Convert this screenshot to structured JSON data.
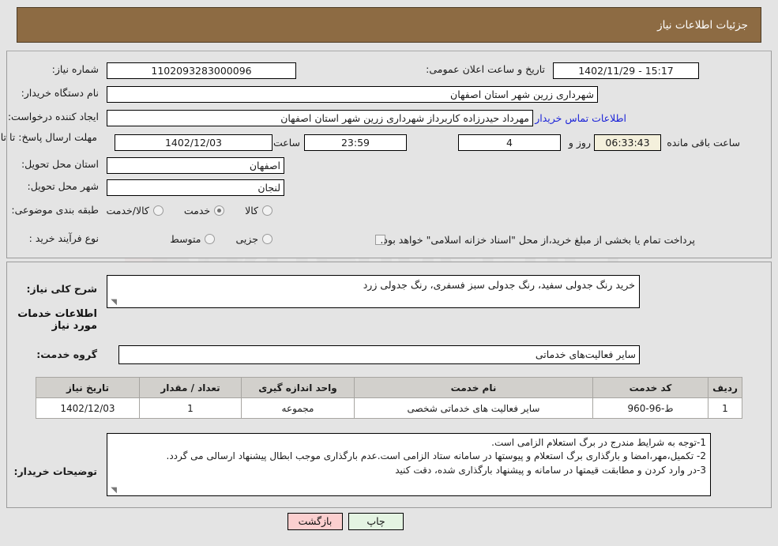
{
  "header": {
    "title": "جزئیات اطلاعات نیاز"
  },
  "top_form": {
    "need_number_label": "شماره نیاز:",
    "need_number_value": "1102093283000096",
    "public_announce_label": "تاریخ و ساعت اعلان عمومی:",
    "public_announce_value": "15:17 - 1402/11/29",
    "buyer_org_label": "نام دستگاه خریدار:",
    "buyer_org_value": "شهرداری زرین شهر استان اصفهان",
    "creator_label": "ایجاد کننده درخواست:",
    "creator_value": "مهرداد حیدرزاده کاربرداز شهرداری زرین شهر استان اصفهان",
    "buyer_contact_link": "اطلاعات تماس خریدار",
    "deadline_label": "مهلت ارسال پاسخ: تا تاریخ:",
    "deadline_date": "1402/12/03",
    "deadline_hour_label": "ساعت",
    "deadline_hour": "23:59",
    "remaining_days": "4",
    "remaining_days_label": "روز و",
    "remaining_time": "06:33:43",
    "remaining_time_label": "ساعت باقی مانده",
    "province_label": "استان محل تحویل:",
    "province_value": "اصفهان",
    "city_label": "شهر محل تحویل:",
    "city_value": "لنجان",
    "classification_label": "طبقه بندی موضوعی:",
    "classification_options": [
      {
        "label": "کالا",
        "selected": false
      },
      {
        "label": "خدمت",
        "selected": true
      },
      {
        "label": "کالا/خدمت",
        "selected": false
      }
    ],
    "process_type_label": "نوع فرآیند خرید :",
    "process_type_options": [
      {
        "label": "جزیی",
        "selected": false
      },
      {
        "label": "متوسط",
        "selected": false
      }
    ],
    "treasury_checkbox_checked": false,
    "treasury_text": "پرداخت تمام یا بخشی از مبلغ خرید،از محل \"اسناد خزانه اسلامی\" خواهد بود."
  },
  "need_description": {
    "label": "شرح کلی نیاز:",
    "value": "خرید رنگ جدولی سفید، رنگ جدولی سبز فسفری، رنگ جدولی زرد"
  },
  "services_section": {
    "heading": "اطلاعات خدمات مورد نیاز",
    "group_label": "گروه خدمت:",
    "group_value": "سایر فعالیت‌های خدماتی"
  },
  "services_table": {
    "columns": [
      "ردیف",
      "کد خدمت",
      "نام خدمت",
      "واحد اندازه گیری",
      "تعداد / مقدار",
      "تاریخ نیاز"
    ],
    "rows": [
      {
        "row_no": "1",
        "code": "ط-96-960",
        "name": "سایر فعالیت های خدماتی شخصی",
        "unit": "مجموعه",
        "quantity": "1",
        "need_date": "1402/12/03"
      }
    ]
  },
  "buyer_notes": {
    "label": "توضیحات خریدار:",
    "lines": [
      "1-توجه به شرایط مندرج در برگ استعلام الزامی است.",
      "2- تکمیل،مهر،امضا و بارگذاری برگ استعلام و پیوستها در سامانه ستاد الزامی است.عدم بارگذاری موجب ابطال پیشنهاد ارسالی می گردد.",
      "3-در وارد کردن و مطابقت قیمتها در سامانه و پیشنهاد بارگذاری شده، دقت کنید"
    ]
  },
  "footer": {
    "print_label": "چاپ",
    "back_label": "بازگشت"
  },
  "watermark": {
    "text": "AriaTender.net"
  },
  "colors": {
    "header_bg": "#8d6b43",
    "page_bg": "#e4e4e4",
    "link": "#1b23d8",
    "countdown_bg": "#f4f0dc",
    "table_header_bg": "#d2d0cc",
    "print_btn_bg": "#e4f4e2",
    "back_btn_bg": "#fbcfcf"
  }
}
